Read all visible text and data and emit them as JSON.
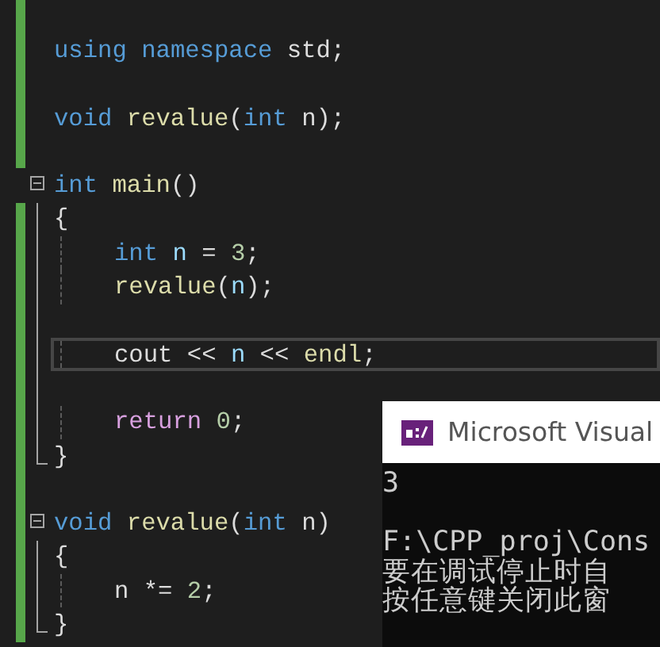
{
  "editor": {
    "lines": [
      {
        "changed": true,
        "kind": "plain",
        "indented": false,
        "current": false
      },
      {
        "changed": true,
        "kind": "plain",
        "indented": false,
        "current": false,
        "tokens": [
          {
            "text": "using",
            "kind": "keyword"
          },
          {
            "text": " namespace",
            "kind": "keyword"
          },
          {
            "text": " std;",
            "kind": "plain"
          }
        ]
      },
      {
        "changed": true,
        "kind": "plain",
        "indented": false,
        "current": false
      },
      {
        "changed": true,
        "kind": "plain",
        "indented": false,
        "current": false,
        "tokens": [
          {
            "text": "void",
            "kind": "keyword"
          },
          {
            "text": " revalue",
            "kind": "function"
          },
          {
            "text": "(",
            "kind": "plain"
          },
          {
            "text": "int",
            "kind": "keyword"
          },
          {
            "text": " n);",
            "kind": "plain"
          }
        ]
      },
      {
        "changed": true,
        "kind": "plain",
        "indented": false,
        "current": false
      },
      {
        "changed": false,
        "kind": "fold-start",
        "indented": false,
        "current": false,
        "tokens": [
          {
            "text": "int",
            "kind": "keyword"
          },
          {
            "text": " main",
            "kind": "function"
          },
          {
            "text": "()",
            "kind": "plain"
          }
        ]
      },
      {
        "changed": true,
        "kind": "fold-body",
        "indented": false,
        "current": false,
        "tokens": [
          {
            "text": "{",
            "kind": "plain"
          }
        ]
      },
      {
        "changed": true,
        "kind": "fold-body",
        "indented": true,
        "current": false,
        "tokens": [
          {
            "text": "int",
            "kind": "keyword"
          },
          {
            "text": " n",
            "kind": "param"
          },
          {
            "text": " = ",
            "kind": "plain"
          },
          {
            "text": "3",
            "kind": "number"
          },
          {
            "text": ";",
            "kind": "plain"
          }
        ]
      },
      {
        "changed": true,
        "kind": "fold-body",
        "indented": true,
        "current": false,
        "tokens": [
          {
            "text": "revalue",
            "kind": "function"
          },
          {
            "text": "(",
            "kind": "plain"
          },
          {
            "text": "n",
            "kind": "param"
          },
          {
            "text": ");",
            "kind": "plain"
          }
        ]
      },
      {
        "changed": true,
        "kind": "fold-body",
        "indented": false,
        "current": false
      },
      {
        "changed": true,
        "kind": "fold-body",
        "indented": true,
        "current": true,
        "tokens": [
          {
            "text": "cout << ",
            "kind": "plain"
          },
          {
            "text": "n",
            "kind": "param"
          },
          {
            "text": " << ",
            "kind": "plain"
          },
          {
            "text": "endl",
            "kind": "function"
          },
          {
            "text": ";",
            "kind": "plain"
          }
        ]
      },
      {
        "changed": true,
        "kind": "fold-body",
        "indented": false,
        "current": false
      },
      {
        "changed": true,
        "kind": "fold-body",
        "indented": true,
        "current": false,
        "tokens": [
          {
            "text": "return",
            "kind": "control"
          },
          {
            "text": " 0",
            "kind": "number"
          },
          {
            "text": ";",
            "kind": "plain"
          }
        ]
      },
      {
        "changed": true,
        "kind": "fold-end",
        "indented": false,
        "current": false,
        "tokens": [
          {
            "text": "}",
            "kind": "plain"
          }
        ]
      },
      {
        "changed": true,
        "kind": "plain",
        "indented": false,
        "current": false
      },
      {
        "changed": true,
        "kind": "fold-start",
        "indented": false,
        "current": false,
        "tokens": [
          {
            "text": "void",
            "kind": "keyword"
          },
          {
            "text": " revalue",
            "kind": "function"
          },
          {
            "text": "(",
            "kind": "plain"
          },
          {
            "text": "int",
            "kind": "keyword"
          },
          {
            "text": " n)",
            "kind": "plain"
          }
        ]
      },
      {
        "changed": true,
        "kind": "fold-body",
        "indented": false,
        "current": false,
        "tokens": [
          {
            "text": "{",
            "kind": "plain"
          }
        ]
      },
      {
        "changed": true,
        "kind": "fold-body",
        "indented": true,
        "current": false,
        "tokens": [
          {
            "text": "n *= ",
            "kind": "plain"
          },
          {
            "text": "2",
            "kind": "number"
          },
          {
            "text": ";",
            "kind": "plain"
          }
        ]
      },
      {
        "changed": true,
        "kind": "fold-end",
        "indented": false,
        "current": false,
        "tokens": [
          {
            "text": "}",
            "kind": "plain"
          }
        ]
      }
    ]
  },
  "console": {
    "title": "Microsoft Visual",
    "lines": [
      "3",
      "F:\\CPP_proj\\Cons",
      "要在调试停止时自",
      "按任意键关闭此窗"
    ]
  }
}
